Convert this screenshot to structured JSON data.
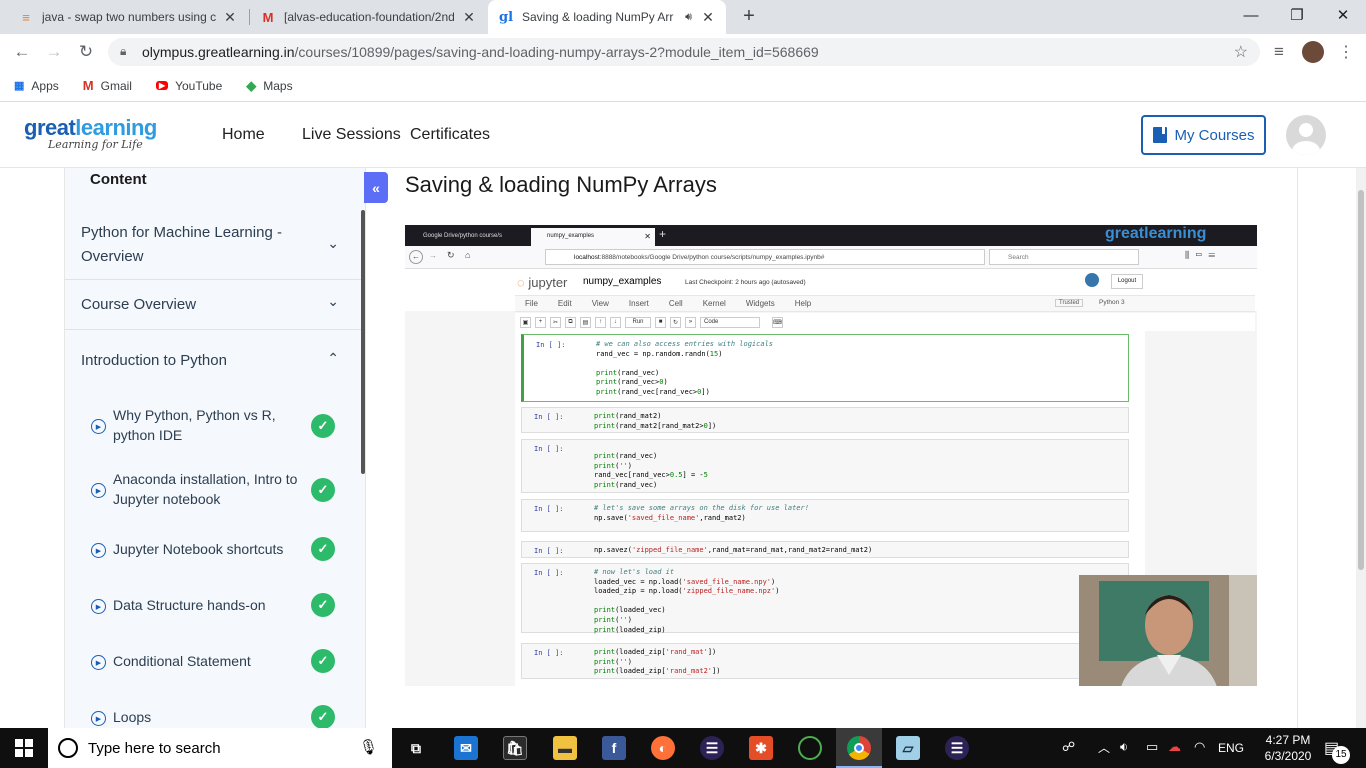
{
  "browser": {
    "tabs": [
      {
        "title": "java - swap two numbers using c",
        "icon": "stackoverflow-icon"
      },
      {
        "title": "[alvas-education-foundation/2nd",
        "icon": "gmail-icon"
      },
      {
        "title": "Saving & loading NumPy Arr",
        "icon": "greatlearning-icon",
        "active": true
      }
    ],
    "url_host": "olympus.greatlearning.in",
    "url_path": "/courses/10899/pages/saving-and-loading-numpy-arrays-2?module_item_id=568669",
    "bookmarks": [
      "Apps",
      "Gmail",
      "YouTube",
      "Maps"
    ]
  },
  "site": {
    "logo_main_a": "great",
    "logo_main_b": "learning",
    "logo_tagline": "Learning for Life",
    "nav": [
      "Home",
      "Live Sessions",
      "Certificates"
    ],
    "my_courses": "My Courses"
  },
  "sidebar": {
    "title": "Content",
    "collapse_glyph": "«",
    "sections": [
      {
        "title": "Python for Machine Learning - Overview",
        "expanded": false
      },
      {
        "title": "Course Overview",
        "expanded": false
      },
      {
        "title": "Introduction to Python",
        "expanded": true
      }
    ],
    "lessons": [
      {
        "title": "Why Python, Python vs R, python IDE",
        "completed": true
      },
      {
        "title": "Anaconda installation, Intro to Jupyter notebook",
        "completed": true
      },
      {
        "title": "Jupyter Notebook shortcuts",
        "completed": true
      },
      {
        "title": "Data Structure hands-on",
        "completed": true
      },
      {
        "title": "Conditional Statement",
        "completed": true
      },
      {
        "title": "Loops",
        "completed": true
      }
    ]
  },
  "page": {
    "title": "Saving & loading NumPy Arrays"
  },
  "video": {
    "tab1": "Google Drive/python course/s",
    "tab2": "numpy_examples",
    "watermark": "greatlearning",
    "watermark_tag": "Learning for Life",
    "url_host": "localhost",
    "url_rest": ":8888/notebooks/Google Drive/python course/scripts/numpy_examples.ipynb#",
    "search": "Search",
    "jupyter": "jupyter",
    "notebook_name": "numpy_examples",
    "checkpoint": "Last Checkpoint: 2 hours ago",
    "autosaved": "(autosaved)",
    "logout": "Logout",
    "menu": [
      "File",
      "Edit",
      "View",
      "Insert",
      "Cell",
      "Kernel",
      "Widgets",
      "Help"
    ],
    "trusted": "Trusted",
    "kernel": "Python 3",
    "run": "Run",
    "cell_type": "Code",
    "prompt": "In [ ]:"
  },
  "taskbar": {
    "search_placeholder": "Type here to search",
    "time": "4:27 PM",
    "date": "6/3/2020",
    "lang": "ENG",
    "notifications": "15"
  }
}
